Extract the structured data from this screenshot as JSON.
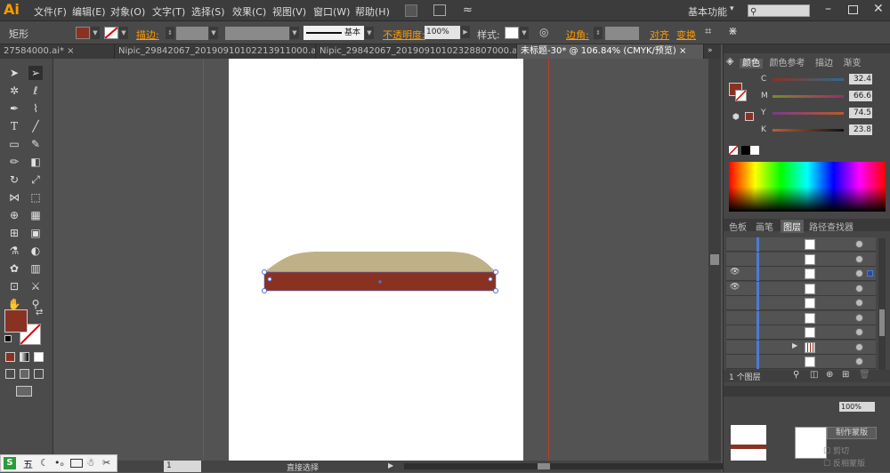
{
  "app": {
    "logo": "Ai",
    "workspace": "基本功能",
    "workspace_dd": "▾"
  },
  "menu": [
    "文件(F)",
    "编辑(E)",
    "对象(O)",
    "文字(T)",
    "选择(S)",
    "效果(C)",
    "视图(V)",
    "窗口(W)",
    "帮助(H)"
  ],
  "control": {
    "object_type": "矩形",
    "stroke_label": "描边:",
    "stroke_style": "基本",
    "opacity_label": "不透明度:",
    "opacity_value": "100%",
    "style_label": "样式:",
    "corner_label": "边角:",
    "align_label": "对齐",
    "transform_label": "变换",
    "fill_color": "#8a3222"
  },
  "tabs": [
    "27584000.ai*",
    "Nipic_29842067_20190910102213911000.ai*",
    "Nipic_29842067_20190910102328807000.ai*",
    "未标题-30* @ 106.84% (CMYK/预览)"
  ],
  "tab_close": "×",
  "color_panel": {
    "tabs": [
      "颜色",
      "颜色参考",
      "描边",
      "渐变"
    ],
    "channels": [
      {
        "label": "C",
        "value": "32.4"
      },
      {
        "label": "M",
        "value": "66.6"
      },
      {
        "label": "Y",
        "value": "74.5"
      },
      {
        "label": "K",
        "value": "23.8"
      }
    ]
  },
  "layers_panel": {
    "tabs": [
      "色板",
      "画笔",
      "图层",
      "路径查找器"
    ],
    "count": "1 个图层",
    "expand_arrow": "▶"
  },
  "status": {
    "zoom": "1",
    "tool": "直接选择"
  },
  "mask_panel": {
    "percent": "100%",
    "make_mask": "制作蒙版",
    "clip": "剪切",
    "invert": "反相蒙版"
  },
  "taskbar": {
    "ime": "五"
  },
  "colors": {
    "fill": "#8a3222",
    "top_shape": "#bfb187",
    "accent": "#ff9a00"
  }
}
